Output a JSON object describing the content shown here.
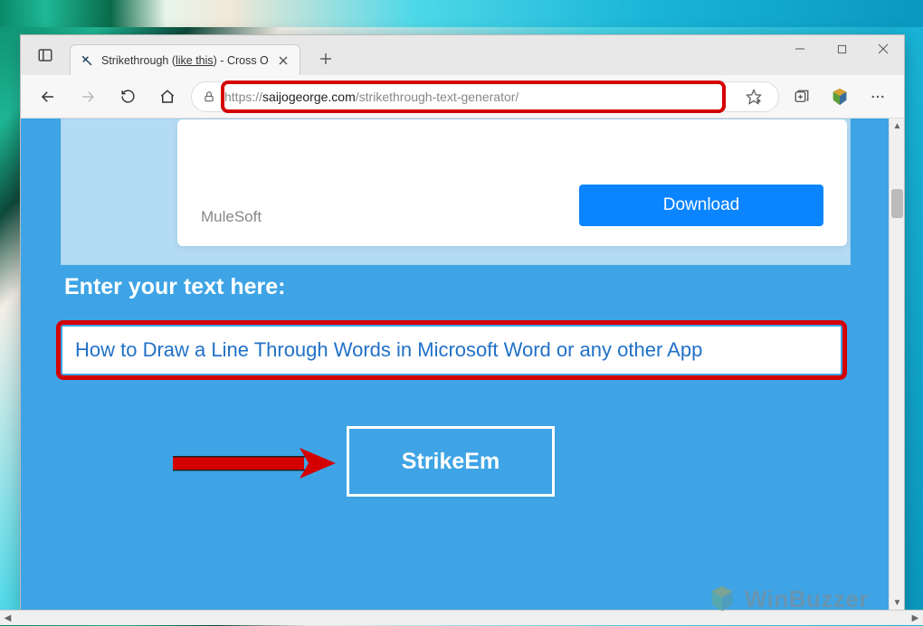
{
  "tab": {
    "title_prefix": "Strikethrough (",
    "title_underline": "like this",
    "title_suffix": ") - Cross O"
  },
  "url": {
    "protocol": "https://",
    "host": "saijogeorge.com",
    "path": "/strikethrough-text-generator/"
  },
  "ad": {
    "brand": "MuleSoft",
    "cta": "Download"
  },
  "page": {
    "prompt": "Enter your text here:",
    "input_value": "How to Draw a Line Through Words in Microsoft Word or any other App",
    "button_label": "StrikeEm"
  },
  "watermark": "WinBuzzer"
}
